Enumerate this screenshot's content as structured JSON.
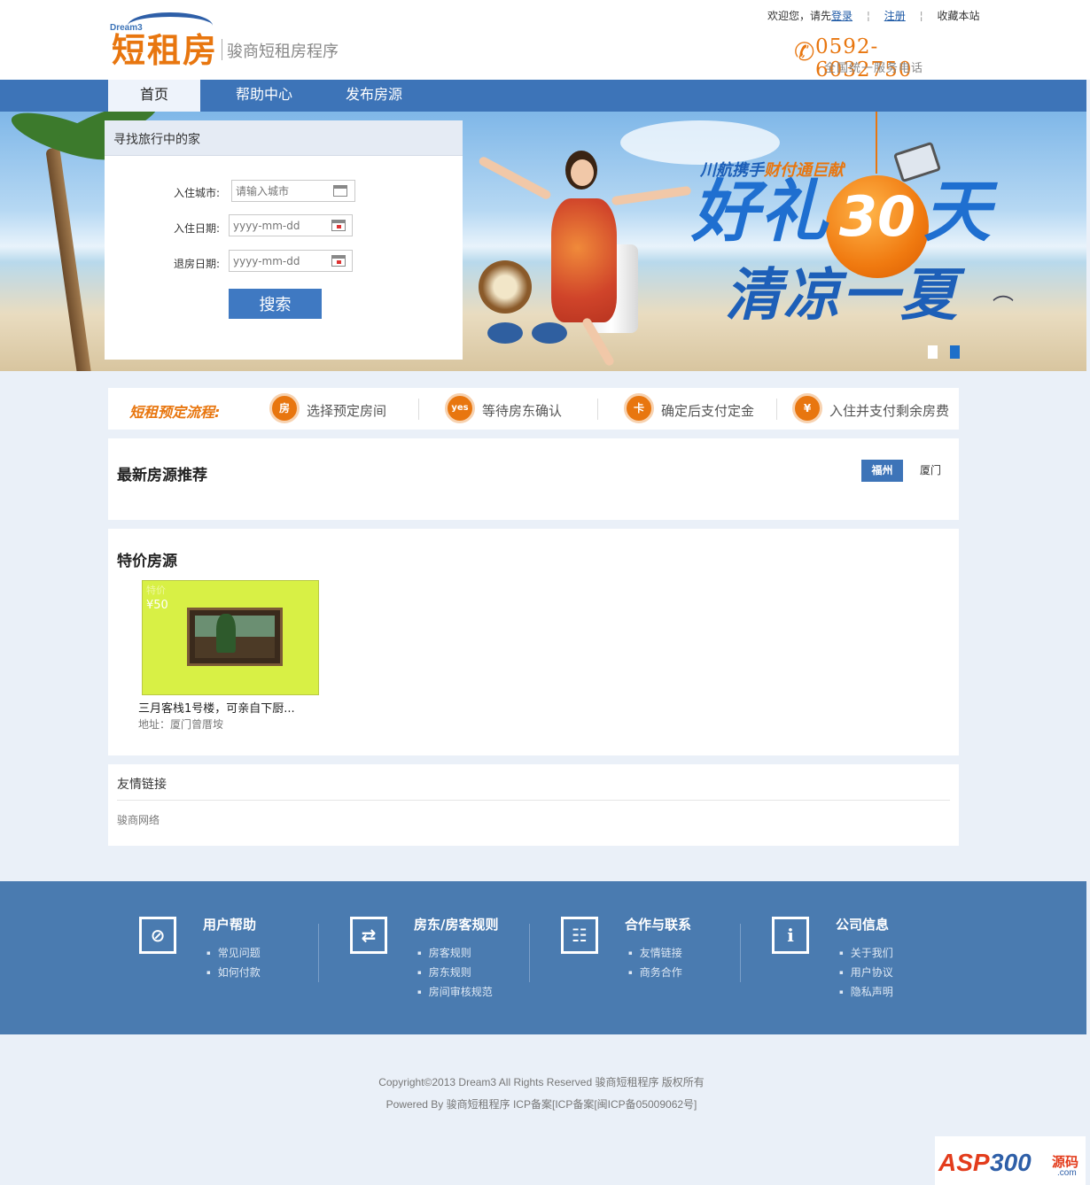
{
  "header": {
    "logo_small": "Dream3",
    "logo_main": "短租房",
    "logo_sub": "骏商短租房程序",
    "welcome": "欢迎您，请先",
    "login": "登录",
    "register": "注册",
    "bookmark": "收藏本站",
    "phone": "0592-6032750",
    "phone_desc": "全国统一服务电话"
  },
  "nav": {
    "items": [
      {
        "label": "首页"
      },
      {
        "label": "帮助中心"
      },
      {
        "label": "发布房源"
      }
    ]
  },
  "banner": {
    "promo_top_a": "川航携手",
    "promo_top_b": "财付通巨献",
    "promo_line1_a": "好礼",
    "promo_num": "30",
    "promo_line1_b": "天",
    "promo_line2": "清凉一夏",
    "slides_total": 2,
    "slide_active": 2
  },
  "search": {
    "title": "寻找旅行中的家",
    "city_label": "入住城市:",
    "city_placeholder": "请输入城市",
    "checkin_label": "入住日期:",
    "checkin_placeholder": "yyyy-mm-dd",
    "checkout_label": "退房日期:",
    "checkout_placeholder": "yyyy-mm-dd",
    "button": "搜索"
  },
  "process": {
    "title": "短租预定流程:",
    "steps": [
      {
        "icon": "房",
        "label": "选择预定房间"
      },
      {
        "icon": "yes",
        "label": "等待房东确认"
      },
      {
        "icon": "卡",
        "label": "确定后支付定金"
      },
      {
        "icon": "¥",
        "label": "入住并支付剩余房费"
      }
    ]
  },
  "latest": {
    "title": "最新房源推荐",
    "tabs": [
      "福州",
      "厦门"
    ]
  },
  "special": {
    "title": "特价房源",
    "listings": [
      {
        "tag": "特价",
        "price": "¥50",
        "name": "三月客栈1号楼，可亲自下厨...",
        "address": "地址：厦门曾厝垵"
      }
    ]
  },
  "friend_links": {
    "title": "友情链接",
    "items": [
      "骏商网络"
    ]
  },
  "footer": {
    "columns": [
      {
        "icon": "compass-icon",
        "glyph": "⊘",
        "title": "用户帮助",
        "items": [
          "常见问题",
          "如何付款"
        ]
      },
      {
        "icon": "exchange-icon",
        "glyph": "⇄",
        "title": "房东/房客规则",
        "items": [
          "房客规则",
          "房东规则",
          "房间审核规范"
        ]
      },
      {
        "icon": "people-icon",
        "glyph": "☷",
        "title": "合作与联系",
        "items": [
          "友情链接",
          "商务合作"
        ]
      },
      {
        "icon": "info-icon",
        "glyph": "i",
        "title": "公司信息",
        "items": [
          "关于我们",
          "用户协议",
          "隐私声明"
        ]
      }
    ],
    "copyright": "Copyright©2013 Dream3 All Rights Reserved 骏商短租程序  版权所有",
    "powered": "Powered By 骏商短租程序  ICP备案[ICP备案[闽ICP备05009062号]"
  },
  "watermark": {
    "asp": "ASP",
    "num": "300",
    "cn": "源码",
    "com": ".com"
  },
  "colors": {
    "nav_blue": "#3d74b8",
    "accent_orange": "#e8760f",
    "footer_blue": "#4a7bb0"
  }
}
